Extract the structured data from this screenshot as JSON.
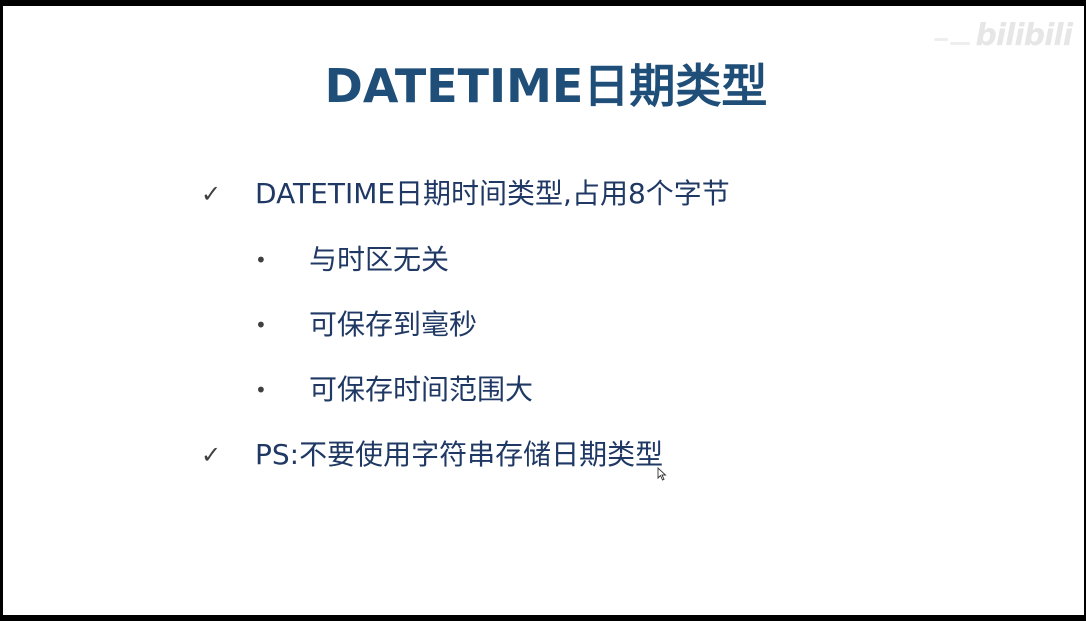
{
  "slide": {
    "title": "DATETIME日期类型",
    "items": [
      {
        "marker": "✓",
        "text": "DATETIME日期时间类型,占用8个字节"
      },
      {
        "marker": "•",
        "text": "与时区无关"
      },
      {
        "marker": "•",
        "text": "可保存到毫秒"
      },
      {
        "marker": "•",
        "text": "可保存时间范围大"
      },
      {
        "marker": "✓",
        "text": "PS:不要使用字符串存储日期类型"
      }
    ]
  },
  "watermark": {
    "text": "bilibili"
  },
  "colors": {
    "title": "#1f4e79",
    "body": "#1f3864",
    "marker": "#404040",
    "background": "#ffffff",
    "border": "#000000"
  }
}
